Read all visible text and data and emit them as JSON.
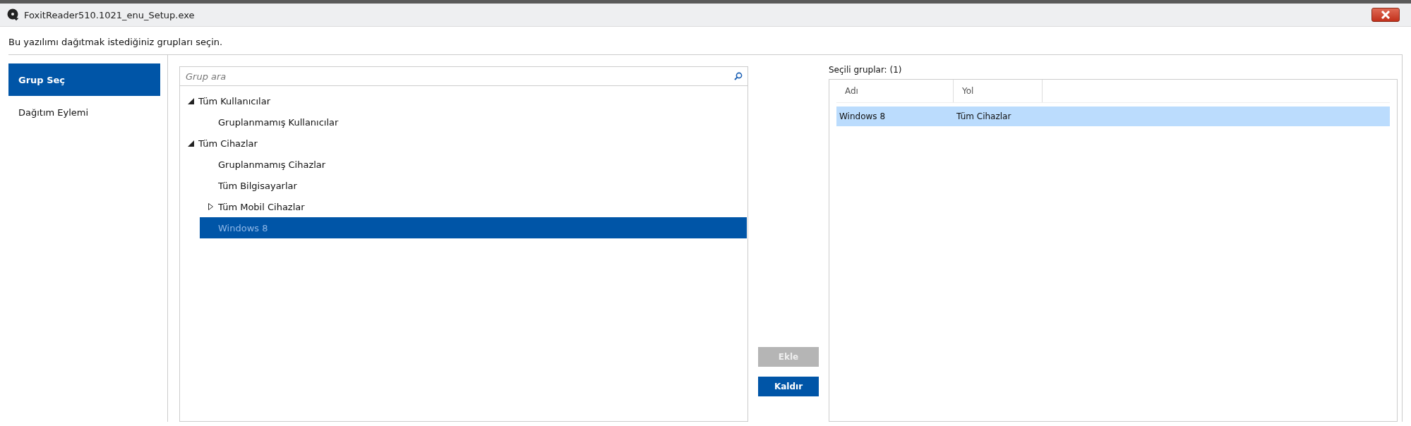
{
  "window": {
    "title": "FoxitReader510.1021_enu_Setup.exe"
  },
  "instruction": "Bu yazılımı dağıtmak istediğiniz grupları seçin.",
  "sidebar": {
    "items": [
      {
        "label": "Grup Seç",
        "selected": true
      },
      {
        "label": "Dağıtım Eylemi",
        "selected": false
      }
    ]
  },
  "search": {
    "placeholder": "Grup ara"
  },
  "tree": [
    {
      "label": "Tüm Kullanıcılar",
      "kind": "expandable",
      "expanded": true,
      "selected": false,
      "children": [
        {
          "label": "Gruplanmamış Kullanıcılar",
          "kind": "leaf",
          "selected": false
        }
      ]
    },
    {
      "label": "Tüm Cihazlar",
      "kind": "expandable",
      "expanded": true,
      "selected": false,
      "children": [
        {
          "label": "Gruplanmamış Cihazlar",
          "kind": "leaf",
          "selected": false
        },
        {
          "label": "Tüm Bilgisayarlar",
          "kind": "leaf",
          "selected": false
        },
        {
          "label": "Tüm Mobil Cihazlar",
          "kind": "expandable",
          "expanded": false,
          "selected": false
        },
        {
          "label": "Windows 8",
          "kind": "leaf",
          "selected": true
        }
      ]
    }
  ],
  "buttons": [
    {
      "label": "Ekle",
      "disabled": true
    },
    {
      "label": "Kaldır",
      "disabled": false
    }
  ],
  "selected_groups": {
    "label": "Seçili gruplar: (1)",
    "columns": [
      "Adı",
      "Yol"
    ],
    "rows": [
      {
        "cells": [
          "Windows 8",
          "Tüm Cihazlar"
        ],
        "selected": true
      }
    ]
  }
}
